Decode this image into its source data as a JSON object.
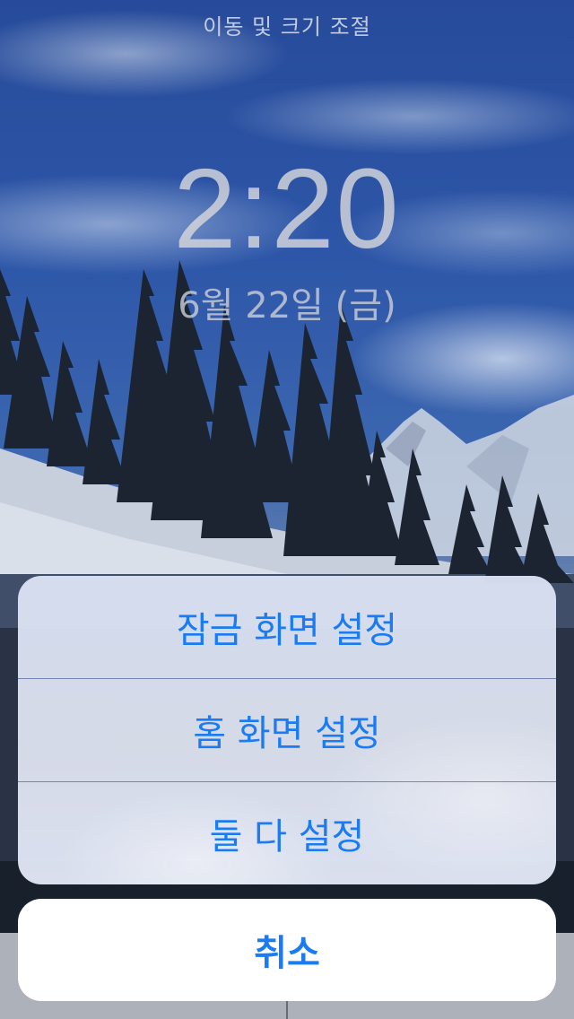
{
  "screen": {
    "hint_title": "이동 및 크기 조절",
    "clock": {
      "time": "2:20",
      "date": "6월 22일 (금)"
    }
  },
  "action_sheet": {
    "items": [
      {
        "label": "잠금 화면 설정"
      },
      {
        "label": "홈 화면 설정"
      },
      {
        "label": "둘 다 설정"
      }
    ],
    "cancel_label": "취소",
    "accent_color": "#1a7bf2"
  }
}
